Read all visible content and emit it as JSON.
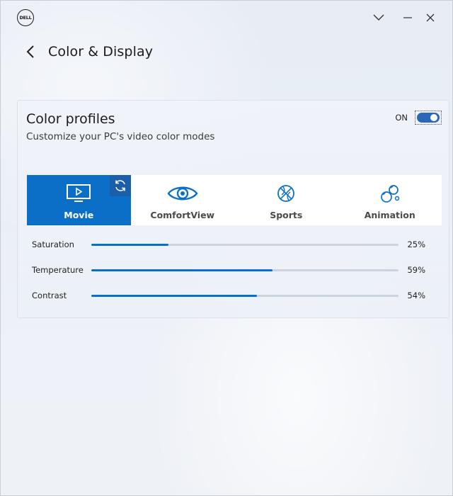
{
  "window": {
    "logo_text": "DELL"
  },
  "header": {
    "title": "Color & Display"
  },
  "color_profiles": {
    "title": "Color profiles",
    "subtitle": "Customize your PC's video color modes",
    "toggle_label": "ON",
    "toggle_on": true,
    "modes": [
      {
        "label": "Movie",
        "icon": "monitor-play-icon",
        "active": true
      },
      {
        "label": "ComfortView",
        "icon": "eye-icon",
        "active": false
      },
      {
        "label": "Sports",
        "icon": "basketball-icon",
        "active": false
      },
      {
        "label": "Animation",
        "icon": "bubbles-icon",
        "active": false
      }
    ],
    "sliders": [
      {
        "label": "Saturation",
        "value": 25,
        "display": "25%"
      },
      {
        "label": "Temperature",
        "value": 59,
        "display": "59%"
      },
      {
        "label": "Contrast",
        "value": 54,
        "display": "54%"
      }
    ]
  },
  "colors": {
    "accent": "#0b6fc8",
    "toggle": "#2b67b9",
    "reset_button": "#1c5fa8"
  }
}
